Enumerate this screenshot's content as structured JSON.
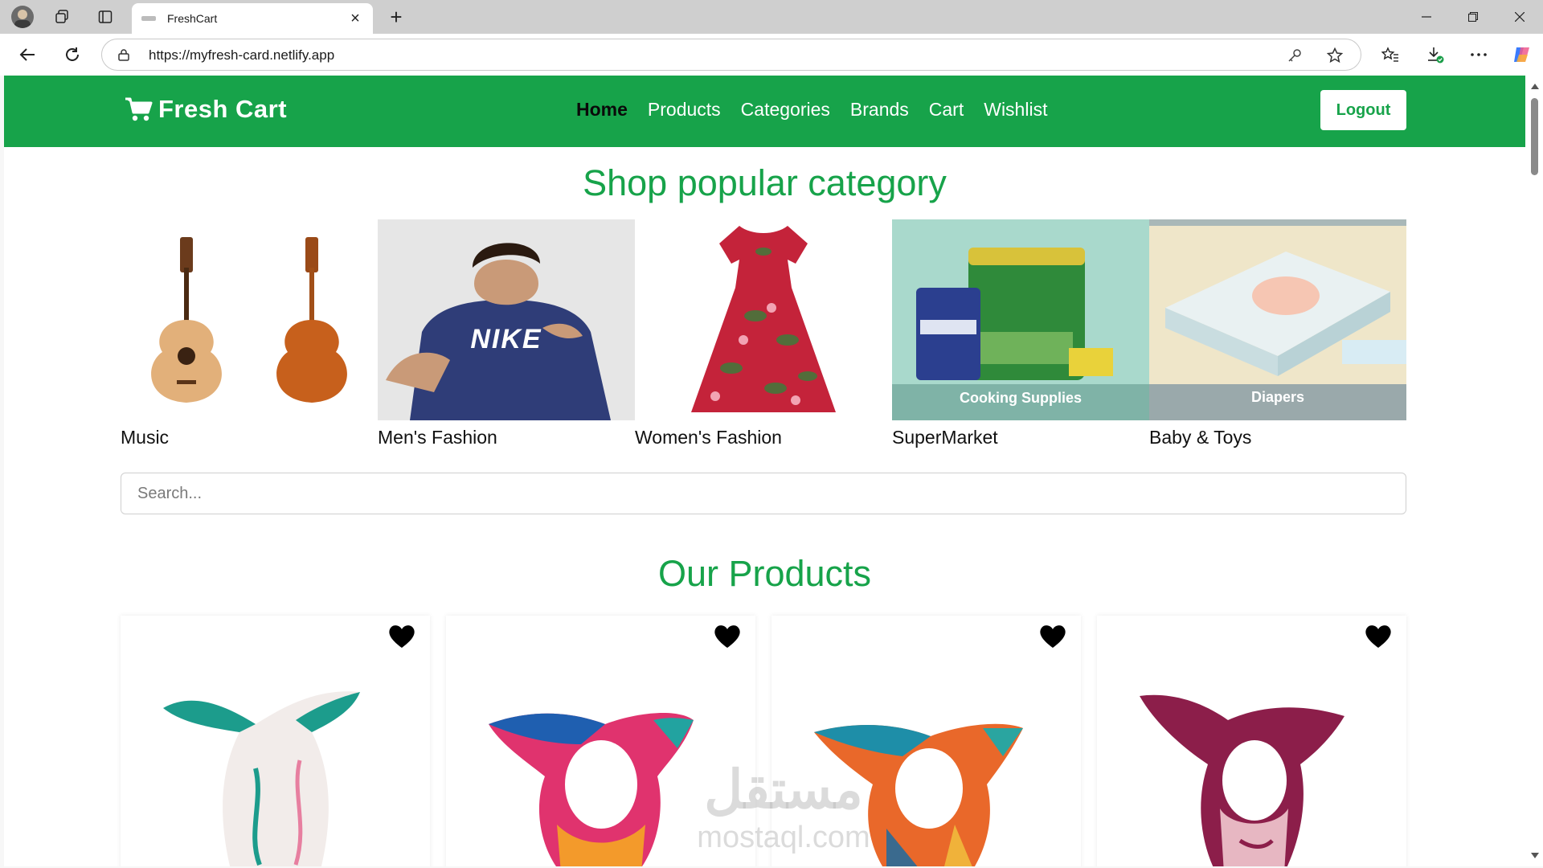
{
  "browser": {
    "tab_title": "FreshCart",
    "url": "https://myfresh-card.netlify.app"
  },
  "navbar": {
    "brand": "Fresh Cart",
    "links": [
      "Home",
      "Products",
      "Categories",
      "Brands",
      "Cart",
      "Wishlist"
    ],
    "active_link": "Home",
    "logout_label": "Logout"
  },
  "categories_section": {
    "title": "Shop popular category",
    "items": [
      {
        "name": "Music"
      },
      {
        "name": "Men's Fashion",
        "image_text": "NIKE"
      },
      {
        "name": "Women's Fashion"
      },
      {
        "name": "SuperMarket",
        "image_text": "Cooking Supplies"
      },
      {
        "name": "Baby & Toys",
        "image_text": "Diapers"
      }
    ]
  },
  "search": {
    "placeholder": "Search..."
  },
  "products_section": {
    "title": "Our Products",
    "wishlist_icon": "heart-icon",
    "products": [
      {
        "image": "scarf-white-teal"
      },
      {
        "image": "scarf-pink-blue"
      },
      {
        "image": "scarf-teal-orange"
      },
      {
        "image": "scarf-burgundy-pink"
      }
    ]
  },
  "watermark": {
    "arabic": "مستقل",
    "latin": "mostaql.com"
  },
  "colors": {
    "brand_green": "#17a34a",
    "navbar_text": "#ffffff",
    "active_link": "#0a0a0a"
  }
}
